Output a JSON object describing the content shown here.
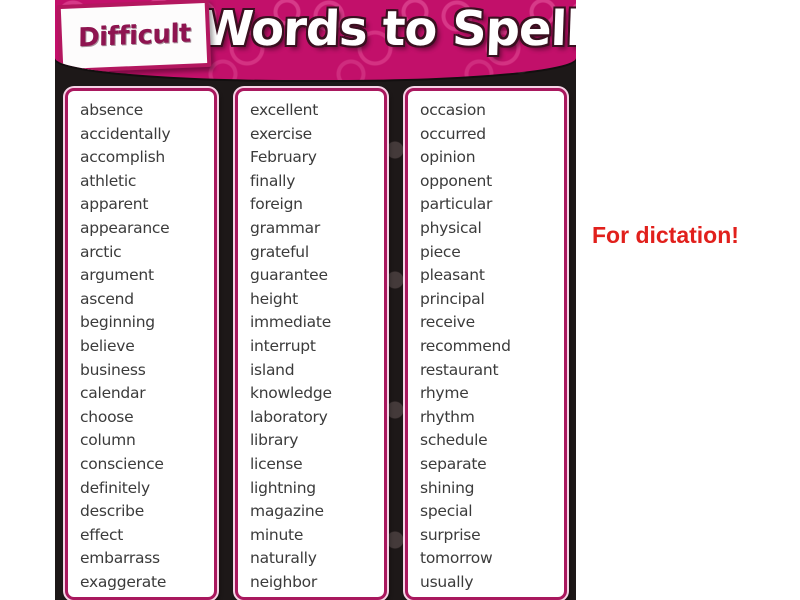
{
  "poster": {
    "banner": {
      "tag_label": "Difficult",
      "title": "Words to Spell"
    },
    "columns": [
      {
        "name": "column-1",
        "words": [
          "absence",
          "accidentally",
          "accomplish",
          "athletic",
          "apparent",
          "appearance",
          "arctic",
          "argument",
          "ascend",
          "beginning",
          "believe",
          "business",
          "calendar",
          "choose",
          "column",
          "conscience",
          "definitely",
          "describe",
          "effect",
          "embarrass",
          "exaggerate"
        ]
      },
      {
        "name": "column-2",
        "words": [
          "excellent",
          "exercise",
          "February",
          "finally",
          "foreign",
          "grammar",
          "grateful",
          "guarantee",
          "height",
          "immediate",
          "interrupt",
          "island",
          "knowledge",
          "laboratory",
          "library",
          "license",
          "lightning",
          "magazine",
          "minute",
          "naturally",
          "neighbor"
        ]
      },
      {
        "name": "column-3",
        "words": [
          "occasion",
          "occurred",
          "opinion",
          "opponent",
          "particular",
          "physical",
          "piece",
          "pleasant",
          "principal",
          "receive",
          "recommend",
          "restaurant",
          "rhyme",
          "rhythm",
          "schedule",
          "separate",
          "shining",
          "special",
          "surprise",
          "tomorrow",
          "usually"
        ]
      }
    ]
  },
  "annotation": {
    "text": "For dictation!"
  },
  "colors": {
    "banner_pink": "#c2106a",
    "tag_text": "#8e1450",
    "card_border": "#a9185e",
    "background_dark": "#1d1818",
    "word_text": "#3b3b3b",
    "annotation_red": "#e1201c",
    "slide_background": "#ffffff"
  }
}
